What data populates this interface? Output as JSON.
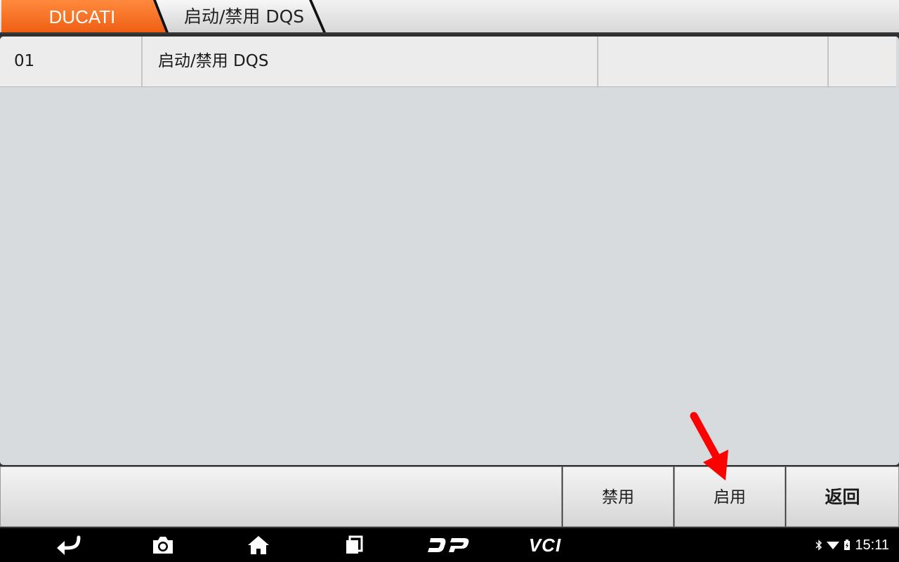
{
  "breadcrumb": {
    "brand": "DUCATI",
    "current": "启动/禁用 DQS",
    "brand_color": "#f2661a"
  },
  "table": {
    "rows": [
      {
        "cells": [
          "01",
          "启动/禁用 DQS",
          "",
          ""
        ]
      }
    ]
  },
  "actions": {
    "disable_label": "禁用",
    "enable_label": "启用",
    "back_label": "返回"
  },
  "navbar": {
    "icons": [
      "back-icon",
      "camera-icon",
      "home-icon",
      "recent-apps-icon",
      "dp-logo-icon",
      "vci-icon"
    ],
    "vci_label": "VCI",
    "time": "15:11"
  },
  "annotation_color": "#ff0000"
}
